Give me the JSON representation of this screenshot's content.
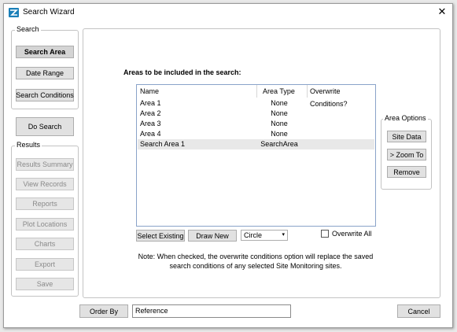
{
  "window": {
    "title": "Search Wizard"
  },
  "search_group": {
    "legend": "Search",
    "buttons": [
      "Search Area",
      "Date Range",
      "Search Conditions"
    ]
  },
  "do_search_label": "Do Search",
  "results_group": {
    "legend": "Results",
    "buttons": [
      "Results Summary",
      "View Records",
      "Reports",
      "Plot Locations",
      "Charts",
      "Export",
      "Save"
    ]
  },
  "main": {
    "heading": "Areas to be included in the search:",
    "columns": [
      "Name",
      "Area Type",
      "Overwrite Conditions?"
    ],
    "rows": [
      {
        "name": "Area 1",
        "type": "None"
      },
      {
        "name": "Area 2",
        "type": "None"
      },
      {
        "name": "Area 3",
        "type": "None"
      },
      {
        "name": "Area 4",
        "type": "None"
      },
      {
        "name": "Search Area 1",
        "type": "SearchArea"
      }
    ],
    "select_existing_label": "Select Existing",
    "draw_new_label": "Draw New",
    "shape_select": "Circle",
    "overwrite_all_label": "Overwrite All",
    "note_line1": "Note: When checked, the overwrite conditions option will replace the saved",
    "note_line2": "search conditions of any selected Site Monitoring sites."
  },
  "area_options": {
    "legend": "Area Options",
    "buttons": [
      "Site Data",
      "> Zoom To",
      "Remove"
    ]
  },
  "footer": {
    "order_by_label": "Order By",
    "order_by_value": "Reference",
    "cancel_label": "Cancel"
  }
}
